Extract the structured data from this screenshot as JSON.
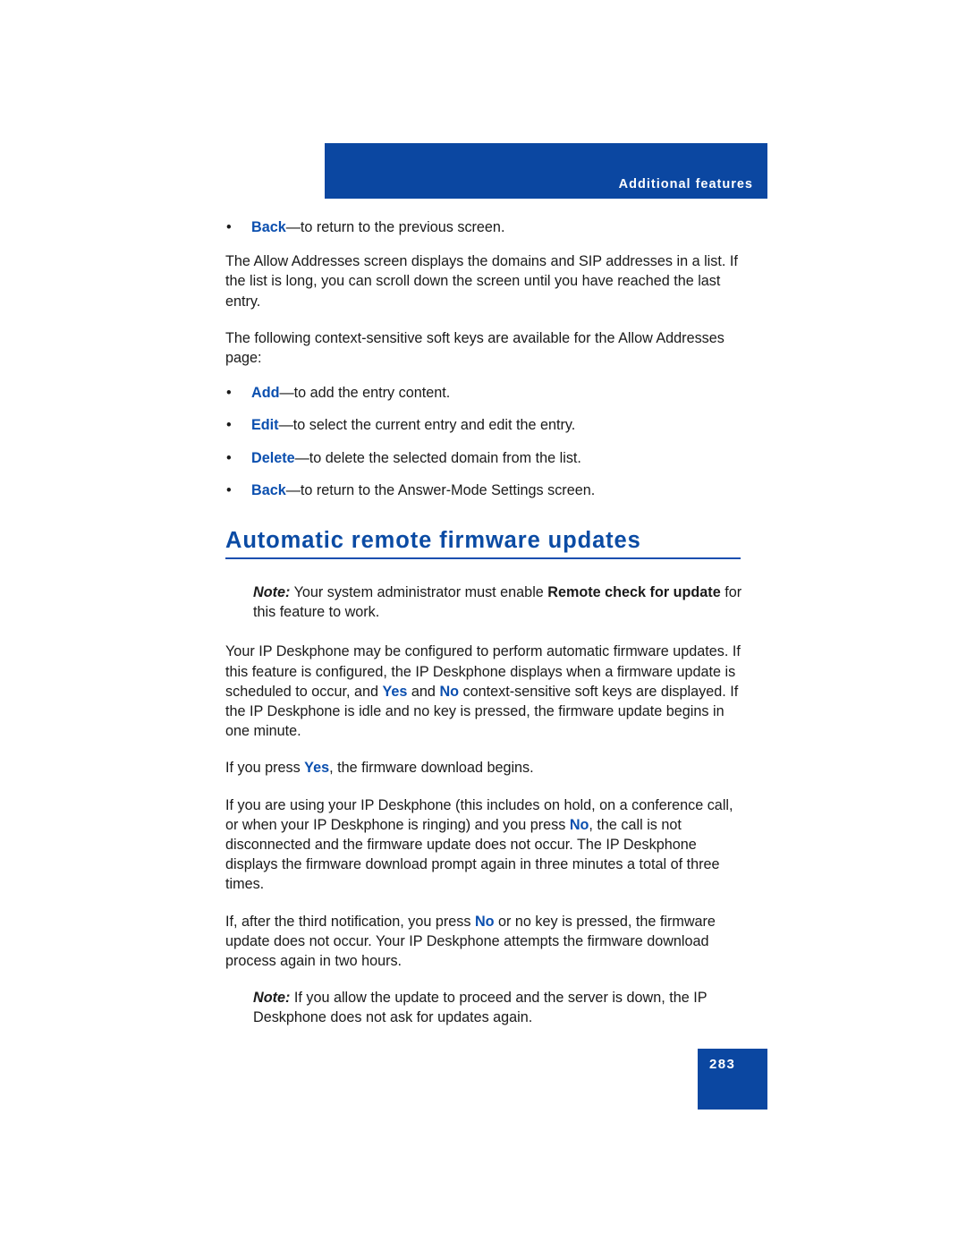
{
  "header": {
    "title": "Additional features",
    "banner_color": "#0B47A1"
  },
  "colors": {
    "accent_blue": "#0B4FAF",
    "heading_blue": "#0B4BA4",
    "banner_blue": "#0B47A1",
    "rule_blue": "#1B4FB0",
    "body_text": "#1a1a1a"
  },
  "content": {
    "bullet_top": {
      "marker": "•",
      "keyword": "Back",
      "rest": "—to return to the previous screen."
    },
    "para_allow_addresses": "The Allow Addresses screen displays the domains and SIP addresses in a list. If the list is long, you can scroll down the screen until you have reached the last entry.",
    "para_softkeys_intro": "The following context-sensitive soft keys are available for the Allow Addresses page:",
    "softkey_bullets": [
      {
        "marker": "•",
        "keyword": "Add",
        "rest": "—to add the entry content."
      },
      {
        "marker": "•",
        "keyword": "Edit",
        "rest": "—to select the current entry and edit the entry."
      },
      {
        "marker": "•",
        "keyword": "Delete",
        "rest": "—to delete the selected domain from the list."
      },
      {
        "marker": "•",
        "keyword": "Back",
        "rest": "—to return to the Answer-Mode Settings screen."
      }
    ],
    "section_heading": "Automatic remote firmware updates",
    "note_one": {
      "label": "Note:",
      "text_before": " Your system administrator must enable ",
      "bold_phrase": "Remote check for update",
      "text_after": " for this feature to work."
    },
    "para_auto_updates": {
      "seg1": "Your IP Deskphone may be configured to perform automatic firmware updates. If this feature is configured, the IP Deskphone displays when a firmware update is scheduled to occur, and ",
      "kw1": "Yes",
      "seg2": " and ",
      "kw2": "No",
      "seg3": " context-sensitive soft keys are displayed. If the IP Deskphone is idle and no key is pressed, the firmware update begins in one minute."
    },
    "para_press_yes": {
      "seg1": "If you press ",
      "kw1": "Yes",
      "seg2": ", the firmware download begins."
    },
    "para_in_use": {
      "seg1": "If you are using your IP Deskphone (this includes on hold, on a conference call, or when your IP Deskphone is ringing) and you press ",
      "kw1": "No",
      "seg2": ", the call is not disconnected and the firmware update does not occur. The IP Deskphone displays the firmware download prompt again in three minutes a total of three times."
    },
    "para_third_notification": {
      "seg1": "If, after the third notification, you press ",
      "kw1": "No",
      "seg2": " or no key is pressed, the firmware update does not occur. Your IP Deskphone attempts the firmware download process again in two hours."
    },
    "note_two": {
      "label": "Note:",
      "text": " If you allow the update to proceed and the server is down, the IP Deskphone does not ask for updates again."
    }
  },
  "footer": {
    "page_number": "283"
  }
}
